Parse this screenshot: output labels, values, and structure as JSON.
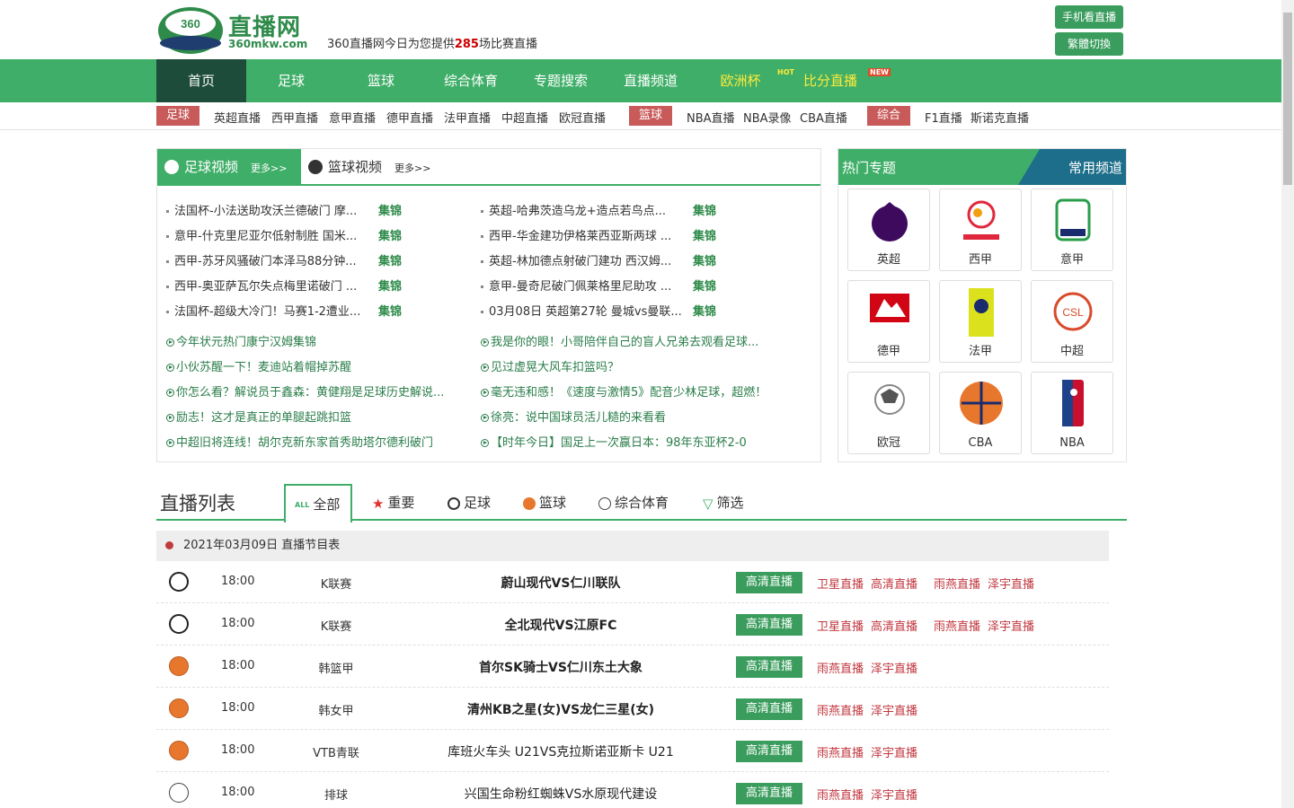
{
  "header": {
    "logo_text": "直播网",
    "logo_badge": "360",
    "logo_domain": "360mkw.com",
    "tagline_pre": "360直播网今日为您提供",
    "tagline_num": "285",
    "tagline_post": "场比赛直播",
    "btn_mobile": "手机看直播",
    "btn_trad": "繁體切換"
  },
  "nav": {
    "items": [
      "首页",
      "足球",
      "篮球",
      "综合体育",
      "专题搜索",
      "直播频道",
      "欧洲杯",
      "比分直播"
    ],
    "hot_tag": "HOT",
    "new_tag": "NEW"
  },
  "subnav": {
    "tag_football": "足球",
    "football_links": [
      "英超直播",
      "西甲直播",
      "意甲直播",
      "德甲直播",
      "法甲直播",
      "中超直播",
      "欧冠直播"
    ],
    "tag_basketball": "篮球",
    "basketball_links": [
      "NBA直播",
      "NBA录像",
      "CBA直播"
    ],
    "tag_other": "综合",
    "other_links": [
      "F1直播",
      "斯诺克直播"
    ]
  },
  "videos": {
    "tab_football": "足球视频",
    "tab_basketball": "篮球视频",
    "more": "更多>>",
    "highlight_label": "集锦",
    "left": [
      "法国杯-小法送助攻沃兰德破门 摩...",
      "意甲-什克里尼亚尔低射制胜 国米...",
      "西甲-苏牙风骚破门本泽马88分钟...",
      "西甲-奥亚萨瓦尔失点梅里诺破门 ...",
      "法国杯-超级大冷门！马赛1-2遭业..."
    ],
    "right": [
      "英超-哈弗茨造乌龙+造点若鸟点...",
      "西甲-华金建功伊格莱西亚斯两球 ...",
      "英超-林加德点射破门建功 西汉姆...",
      "意甲-曼奇尼破门佩莱格里尼助攻 ...",
      "03月08日 英超第27轮 曼城vs曼联..."
    ],
    "green_left": [
      "今年状元热门康宁汉姆集锦",
      "小伙苏醒一下！麦迪站着帽掉苏醒",
      "你怎么看？解说员于鑫森：黄健翔是足球历史解说...",
      "励志！这才是真正的单腿起跳扣篮",
      "中超旧将连线！胡尔克新东家首秀助塔尔德利破门"
    ],
    "green_right": [
      "我是你的眼！小哥陪伴自己的盲人兄弟去观看足球...",
      "见过虚晃大风车扣篮吗？",
      "毫无违和感！《速度与激情5》配音少林足球，超燃！",
      "徐亮：说中国球员活儿糙的来看看",
      "【时年今日】国足上一次赢日本：98年东亚杯2-0"
    ]
  },
  "hot": {
    "title": "热门专题",
    "channels": "常用频道",
    "cards": [
      "英超",
      "西甲",
      "意甲",
      "德甲",
      "法甲",
      "中超",
      "欧冠",
      "CBA",
      "NBA"
    ]
  },
  "list": {
    "title": "直播列表",
    "tabs": [
      "全部",
      "重要",
      "足球",
      "篮球",
      "综合体育",
      "筛选"
    ],
    "all_badge": "ALL",
    "date_header": "2021年03月09日 直播节目表",
    "hd_label": "高清直播",
    "rows": [
      {
        "type": "football",
        "time": "18:00",
        "league": "K联赛",
        "match": "蔚山现代VS仁川联队",
        "links": [
          "卫星直播",
          "高清直播",
          "雨燕直播",
          "泽宇直播"
        ]
      },
      {
        "type": "football",
        "time": "18:00",
        "league": "K联赛",
        "match": "全北现代VS江原FC",
        "links": [
          "卫星直播",
          "高清直播",
          "雨燕直播",
          "泽宇直播"
        ]
      },
      {
        "type": "basketball",
        "time": "18:00",
        "league": "韩篮甲",
        "match": "首尔SK骑士VS仁川东土大象",
        "links": [
          "雨燕直播",
          "泽宇直播"
        ]
      },
      {
        "type": "basketball",
        "time": "18:00",
        "league": "韩女甲",
        "match": "清州KB之星(女)VS龙仁三星(女)",
        "links": [
          "雨燕直播",
          "泽宇直播"
        ]
      },
      {
        "type": "basketball",
        "time": "18:00",
        "league": "VTB青联",
        "match": "库班火车头 U21VS克拉斯诺亚斯卡 U21",
        "links": [
          "雨燕直播",
          "泽宇直播"
        ]
      },
      {
        "type": "other",
        "time": "18:00",
        "league": "排球",
        "match": "兴国生命粉红蜘蛛VS水原现代建设",
        "links": [
          "雨燕直播",
          "泽宇直播"
        ]
      }
    ]
  },
  "colors": {
    "primary": "#3fae68",
    "dark": "#1d4d3a",
    "red": "#c0363e",
    "highlight": "#ffea3a"
  }
}
